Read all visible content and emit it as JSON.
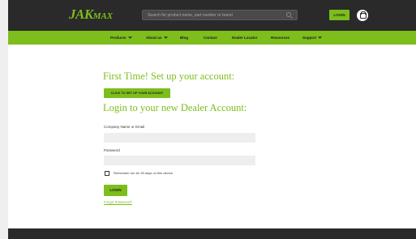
{
  "header": {
    "logo_main": "JAK",
    "logo_small": "MAX",
    "search_placeholder": "Search for product name, part number or brand",
    "login_label": "LOGIN"
  },
  "nav": {
    "items": [
      {
        "label": "Products",
        "has_dropdown": true
      },
      {
        "label": "About us",
        "has_dropdown": true
      },
      {
        "label": "Blog",
        "has_dropdown": false
      },
      {
        "label": "Contact",
        "has_dropdown": false
      },
      {
        "label": "Dealer Locator",
        "has_dropdown": false
      },
      {
        "label": "Resources",
        "has_dropdown": false
      },
      {
        "label": "Support",
        "has_dropdown": true
      }
    ]
  },
  "main": {
    "setup_heading": "First Time! Set up your account:",
    "setup_button": "CLICK TO SET UP YOUR ACCOUNT",
    "login_heading": "Login to your new Dealer Account:",
    "company_label": "Company Name or Email",
    "company_value": "",
    "password_label": "Password",
    "password_value": "",
    "remember_label": "Remember me for 30 days on this device",
    "remember_checked": false,
    "login_button": "LOGIN",
    "forgot_link": "Forgot Password?"
  },
  "colors": {
    "brand_green": "#7dbd1c",
    "header_dark": "#2a2a2a"
  }
}
